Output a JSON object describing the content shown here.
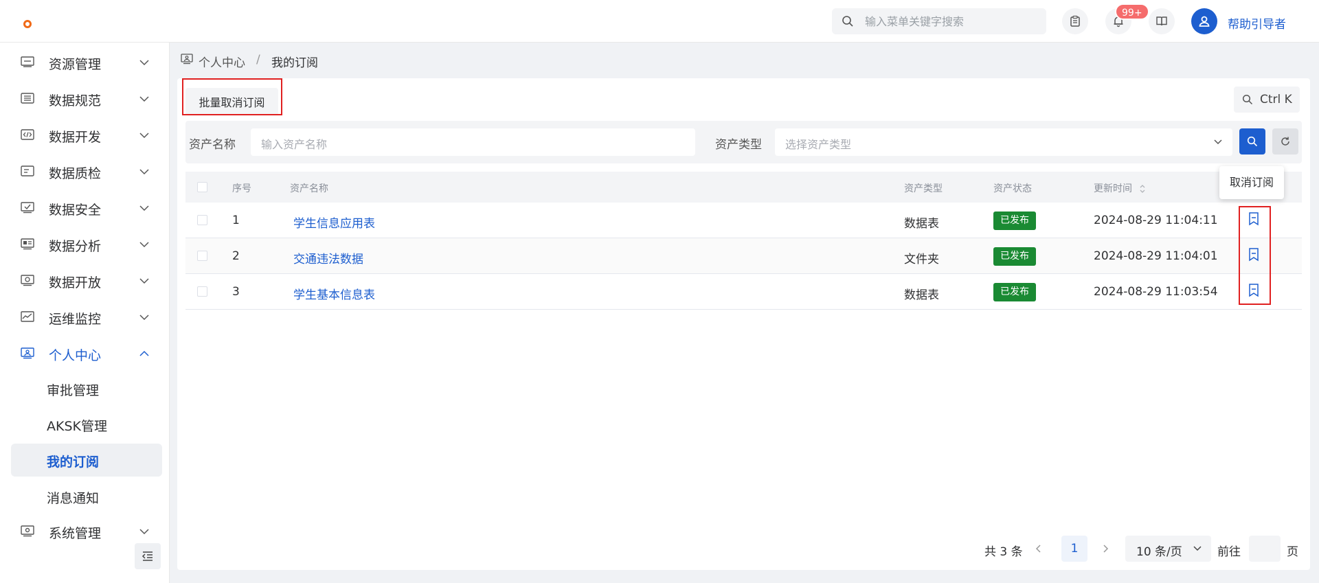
{
  "header": {
    "search_placeholder": "输入菜单关键字搜索",
    "notification_count": "99+",
    "username": "帮助引导者"
  },
  "sidebar": {
    "items": [
      {
        "label": "资源管理",
        "icon": "resource-icon"
      },
      {
        "label": "数据规范",
        "icon": "database-icon"
      },
      {
        "label": "数据开发",
        "icon": "code-icon"
      },
      {
        "label": "数据质检",
        "icon": "inspect-icon"
      },
      {
        "label": "数据安全",
        "icon": "shield-check-icon"
      },
      {
        "label": "数据分析",
        "icon": "analysis-icon"
      },
      {
        "label": "数据开放",
        "icon": "open-data-icon"
      },
      {
        "label": "运维监控",
        "icon": "monitor-icon"
      },
      {
        "label": "个人中心",
        "icon": "personal-icon"
      },
      {
        "label": "系统管理",
        "icon": "settings-icon"
      }
    ],
    "sub_items": [
      {
        "label": "审批管理"
      },
      {
        "label": "AKSK管理"
      },
      {
        "label": "我的订阅"
      },
      {
        "label": "消息通知"
      }
    ]
  },
  "breadcrumb": {
    "parent": "个人中心",
    "separator": "/",
    "current": "我的订阅"
  },
  "toolbar": {
    "batch_unsubscribe_label": "批量取消订阅",
    "shortcut_label": "Ctrl K"
  },
  "filters": {
    "name_label": "资产名称",
    "name_placeholder": "输入资产名称",
    "type_label": "资产类型",
    "type_placeholder": "选择资产类型"
  },
  "table": {
    "columns": [
      "序号",
      "资产名称",
      "资产类型",
      "资产状态",
      "更新时间"
    ],
    "rows": [
      {
        "index": "1",
        "name": "学生信息应用表",
        "type": "数据表",
        "status": "已发布",
        "updated": "2024-08-29 11:04:11"
      },
      {
        "index": "2",
        "name": "交通违法数据",
        "type": "文件夹",
        "status": "已发布",
        "updated": "2024-08-29 11:04:01"
      },
      {
        "index": "3",
        "name": "学生基本信息表",
        "type": "数据表",
        "status": "已发布",
        "updated": "2024-08-29 11:03:54"
      }
    ]
  },
  "tooltip": {
    "text": "取消订阅"
  },
  "pagination": {
    "total": "共 3 条",
    "current_page": "1",
    "page_size": "10 条/页",
    "goto_label": "前往",
    "page_word": "页"
  },
  "colors": {
    "primary": "#1d5ecf",
    "status_published": "#1a8a33",
    "badge": "#f56c6c",
    "highlight": "#e02020",
    "logo": "#f06a18"
  }
}
